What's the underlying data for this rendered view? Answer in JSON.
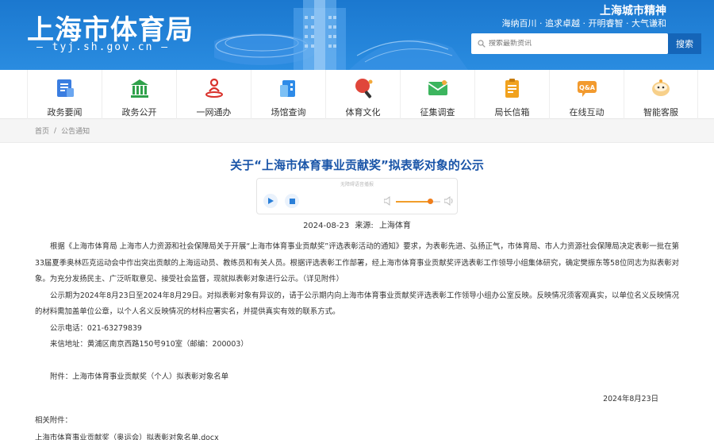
{
  "header": {
    "logo_title": "上海市体育局",
    "logo_url": "— tyj.sh.gov.cn —",
    "spirit_title": "上海城市精神",
    "spirit_subtitle": "海纳百川 · 追求卓越 · 开明睿智 · 大气谦和",
    "search_placeholder": "搜索最新资讯",
    "search_button": "搜索"
  },
  "nav": [
    {
      "label": "政务要闻",
      "icon": "news-icon",
      "color": "#3a7de0"
    },
    {
      "label": "政务公开",
      "icon": "government-building-icon",
      "color": "#2fa14a"
    },
    {
      "label": "一网通办",
      "icon": "network-person-icon",
      "color": "#d9312b"
    },
    {
      "label": "场馆查询",
      "icon": "venue-icon",
      "color": "#2e8be8"
    },
    {
      "label": "体育文化",
      "icon": "pingpong-icon",
      "color": "#e0463a"
    },
    {
      "label": "征集调查",
      "icon": "survey-mail-icon",
      "color": "#3cb55e"
    },
    {
      "label": "局长信箱",
      "icon": "mailbox-clipboard-icon",
      "color": "#f1a21e"
    },
    {
      "label": "在线互动",
      "icon": "qa-chat-icon",
      "color": "#f29a2e"
    },
    {
      "label": "智能客服",
      "icon": "robot-assistant-icon",
      "color": "#f2a93b"
    }
  ],
  "breadcrumb": {
    "home": "首页",
    "separator": "/",
    "current": "公告通知"
  },
  "article": {
    "title": "关于“上海市体育事业贡献奖”拟表彰对象的公示",
    "player_label": "无障碍语音播报",
    "volume_percent": 78,
    "date": "2024-08-23",
    "source_label": "来源:",
    "source": "上海体育",
    "paragraph1": "根据《上海市体育局  上海市人力资源和社会保障局关于开展“上海市体育事业贡献奖”评选表彰活动的通知》要求，为表彰先进、弘扬正气，市体育局、市人力资源社会保障局决定表彰一批在第33届夏季奥林匹克运动会中作出突出贡献的上海运动员、教练员和有关人员。根据评选表彰工作部署，经上海市体育事业贡献奖评选表彰工作领导小组集体研究，确定樊振东等58位同志为拟表彰对象。为充分发扬民主、广泛听取意见、接受社会监督，现就拟表彰对象进行公示。（详见附件）",
    "paragraph2": "公示期为2024年8月23日至2024年8月29日。对拟表彰对象有异议的，请于公示期内向上海市体育事业贡献奖评选表彰工作领导小组办公室反映。反映情况须客观真实，以单位名义反映情况的材料需加盖单位公章，以个人名义反映情况的材料应署实名，并提供真实有效的联系方式。",
    "phone": "公示电话：021-63279839",
    "address": "来信地址：黄浦区南京西路150号910室（邮编：200003）",
    "attachment_note": "附件：上海市体育事业贡献奖（个人）拟表彰对象名单",
    "sign_date": "2024年8月23日",
    "related_label": "相关附件：",
    "related_file": "上海市体育事业贡献奖（奥运会）拟表彰对象名单.docx"
  }
}
